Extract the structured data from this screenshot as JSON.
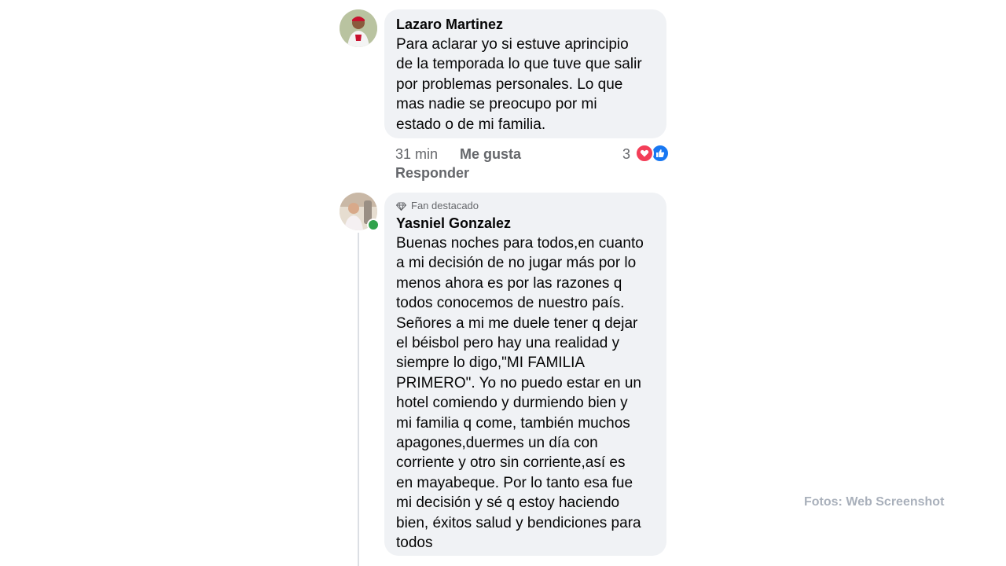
{
  "comments": [
    {
      "author": "Lazaro Martinez",
      "text": "Para aclarar yo si estuve aprincipio\nde la temporada lo que tuve que salir\npor problemas personales. Lo que\nmas nadie se preocupo por mi\nestado o de mi familia.",
      "time": "31 min",
      "like_label": "Me gusta",
      "reply_label": "Responder",
      "reaction_count": "3",
      "reactions": [
        "heart-reaction",
        "like-reaction"
      ]
    },
    {
      "badge": "Fan destacado",
      "author": "Yasniel Gonzalez",
      "text": "Buenas noches para todos,en cuanto\na mi decisión de no jugar más por lo\nmenos ahora es por las razones q\ntodos conocemos de nuestro país.\nSeñores a mi me duele tener q dejar\nel béisbol pero hay una realidad y\nsiempre lo digo,\"MI FAMILIA\nPRIMERO\". Yo no puedo estar en un\nhotel comiendo y durmiendo bien y\nmi familia q come, también muchos\napagones,duermes un día con\ncorriente y otro sin corriente,así es\nen mayabeque. Por lo tanto esa fue\nmi decisión y sé q estoy haciendo\nbien, éxitos salud y bendiciones para\ntodos",
      "online": true
    }
  ],
  "watermark": "Fotos: Web Screenshot",
  "colors": {
    "bubble": "#f0f2f5",
    "meta_text": "#65676b",
    "like_blue": "#1877f2",
    "love_red": "#f33e58",
    "online_green": "#31a24c"
  }
}
